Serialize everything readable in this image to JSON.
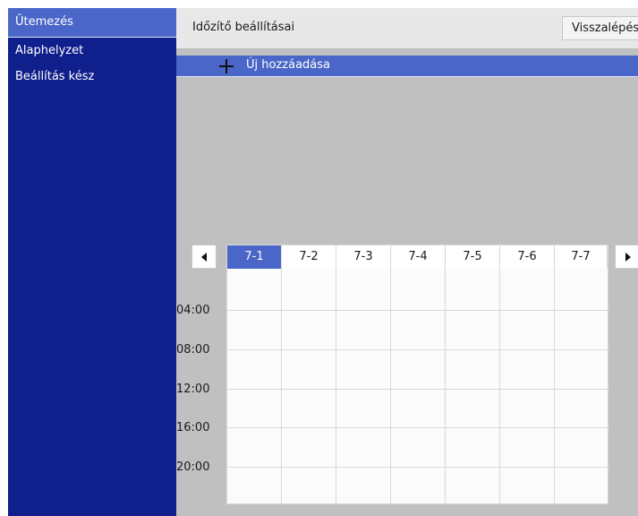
{
  "sidebar": {
    "items": [
      {
        "label": "Ütemezés"
      },
      {
        "label": "Alaphelyzet"
      },
      {
        "label": "Beállítás kész"
      }
    ]
  },
  "header": {
    "title": "Időzítő beállításai",
    "back_label": "Visszalépés"
  },
  "add_row": {
    "label": "Új hozzáadása",
    "icon": "plus-icon"
  },
  "schedule": {
    "prev_icon": "arrow-left-icon",
    "next_icon": "arrow-right-icon",
    "days": [
      "7-1",
      "7-2",
      "7-3",
      "7-4",
      "7-5",
      "7-6",
      "7-7"
    ],
    "selected_day": "7-1",
    "times": [
      "04:00",
      "08:00",
      "12:00",
      "16:00",
      "20:00"
    ]
  },
  "colors": {
    "sidebar_bg": "#0f1f8c",
    "accent": "#4a66c8",
    "content_bg": "#c0c0c0"
  }
}
